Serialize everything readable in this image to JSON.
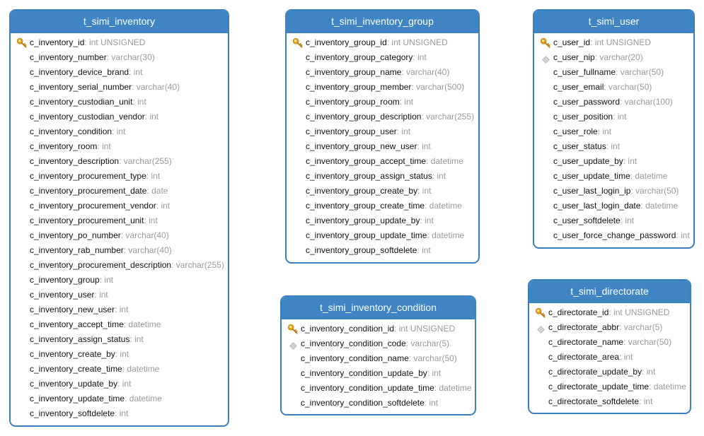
{
  "tables": [
    {
      "id": "tbl-inventory",
      "title": "t_simi_inventory",
      "columns": [
        {
          "name": "c_inventory_id",
          "type": "int UNSIGNED",
          "marker": "key"
        },
        {
          "name": "c_inventory_number",
          "type": "varchar(30)",
          "marker": ""
        },
        {
          "name": "c_inventory_device_brand",
          "type": "int",
          "marker": ""
        },
        {
          "name": "c_inventory_serial_number",
          "type": "varchar(40)",
          "marker": ""
        },
        {
          "name": "c_inventory_custodian_unit",
          "type": "int",
          "marker": ""
        },
        {
          "name": "c_inventory_custodian_vendor",
          "type": "int",
          "marker": ""
        },
        {
          "name": "c_inventory_condition",
          "type": "int",
          "marker": ""
        },
        {
          "name": "c_inventory_room",
          "type": "int",
          "marker": ""
        },
        {
          "name": "c_inventory_description",
          "type": "varchar(255)",
          "marker": ""
        },
        {
          "name": "c_inventory_procurement_type",
          "type": "int",
          "marker": ""
        },
        {
          "name": "c_inventory_procurement_date",
          "type": "date",
          "marker": ""
        },
        {
          "name": "c_inventory_procurement_vendor",
          "type": "int",
          "marker": ""
        },
        {
          "name": "c_inventory_procurement_unit",
          "type": "int",
          "marker": ""
        },
        {
          "name": "c_inventory_po_number",
          "type": "varchar(40)",
          "marker": ""
        },
        {
          "name": "c_inventory_rab_number",
          "type": "varchar(40)",
          "marker": ""
        },
        {
          "name": "c_inventory_procurement_description",
          "type": "varchar(255)",
          "marker": ""
        },
        {
          "name": "c_inventory_group",
          "type": "int",
          "marker": ""
        },
        {
          "name": "c_inventory_user",
          "type": "int",
          "marker": ""
        },
        {
          "name": "c_inventory_new_user",
          "type": "int",
          "marker": ""
        },
        {
          "name": "c_inventory_accept_time",
          "type": "datetime",
          "marker": ""
        },
        {
          "name": "c_inventory_assign_status",
          "type": "int",
          "marker": ""
        },
        {
          "name": "c_inventory_create_by",
          "type": "int",
          "marker": ""
        },
        {
          "name": "c_inventory_create_time",
          "type": "datetime",
          "marker": ""
        },
        {
          "name": "c_inventory_update_by",
          "type": "int",
          "marker": ""
        },
        {
          "name": "c_inventory_update_time",
          "type": "datetime",
          "marker": ""
        },
        {
          "name": "c_inventory_softdelete",
          "type": "int",
          "marker": ""
        }
      ]
    },
    {
      "id": "tbl-inventory-group",
      "title": "t_simi_inventory_group",
      "columns": [
        {
          "name": "c_inventory_group_id",
          "type": "int UNSIGNED",
          "marker": "key"
        },
        {
          "name": "c_inventory_group_category",
          "type": "int",
          "marker": ""
        },
        {
          "name": "c_inventory_group_name",
          "type": "varchar(40)",
          "marker": ""
        },
        {
          "name": "c_inventory_group_member",
          "type": "varchar(500)",
          "marker": ""
        },
        {
          "name": "c_inventory_group_room",
          "type": "int",
          "marker": ""
        },
        {
          "name": "c_inventory_group_description",
          "type": "varchar(255)",
          "marker": ""
        },
        {
          "name": "c_inventory_group_user",
          "type": "int",
          "marker": ""
        },
        {
          "name": "c_inventory_group_new_user",
          "type": "int",
          "marker": ""
        },
        {
          "name": "c_inventory_group_accept_time",
          "type": "datetime",
          "marker": ""
        },
        {
          "name": "c_inventory_group_assign_status",
          "type": "int",
          "marker": ""
        },
        {
          "name": "c_inventory_group_create_by",
          "type": "int",
          "marker": ""
        },
        {
          "name": "c_inventory_group_create_time",
          "type": "datetime",
          "marker": ""
        },
        {
          "name": "c_inventory_group_update_by",
          "type": "int",
          "marker": ""
        },
        {
          "name": "c_inventory_group_update_time",
          "type": "datetime",
          "marker": ""
        },
        {
          "name": "c_inventory_group_softdelete",
          "type": "int",
          "marker": ""
        }
      ]
    },
    {
      "id": "tbl-user",
      "title": "t_simi_user",
      "columns": [
        {
          "name": "c_user_id",
          "type": "int UNSIGNED",
          "marker": "key"
        },
        {
          "name": "c_user_nip",
          "type": "varchar(20)",
          "marker": "unique"
        },
        {
          "name": "c_user_fullname",
          "type": "varchar(50)",
          "marker": ""
        },
        {
          "name": "c_user_email",
          "type": "varchar(50)",
          "marker": ""
        },
        {
          "name": "c_user_password",
          "type": "varchar(100)",
          "marker": ""
        },
        {
          "name": "c_user_position",
          "type": "int",
          "marker": ""
        },
        {
          "name": "c_user_role",
          "type": "int",
          "marker": ""
        },
        {
          "name": "c_user_status",
          "type": "int",
          "marker": ""
        },
        {
          "name": "c_user_update_by",
          "type": "int",
          "marker": ""
        },
        {
          "name": "c_user_update_time",
          "type": "datetime",
          "marker": ""
        },
        {
          "name": "c_user_last_login_ip",
          "type": "varchar(50)",
          "marker": ""
        },
        {
          "name": "c_user_last_login_date",
          "type": "datetime",
          "marker": ""
        },
        {
          "name": "c_user_softdelete",
          "type": "int",
          "marker": ""
        },
        {
          "name": "c_user_force_change_password",
          "type": "int",
          "marker": ""
        }
      ]
    },
    {
      "id": "tbl-inventory-condition",
      "title": "t_simi_inventory_condition",
      "columns": [
        {
          "name": "c_inventory_condition_id",
          "type": "int UNSIGNED",
          "marker": "key"
        },
        {
          "name": "c_inventory_condition_code",
          "type": "varchar(5)",
          "marker": "unique"
        },
        {
          "name": "c_inventory_condition_name",
          "type": "varchar(50)",
          "marker": ""
        },
        {
          "name": "c_inventory_condition_update_by",
          "type": "int",
          "marker": ""
        },
        {
          "name": "c_inventory_condition_update_time",
          "type": "datetime",
          "marker": ""
        },
        {
          "name": "c_inventory_condition_softdelete",
          "type": "int",
          "marker": ""
        }
      ]
    },
    {
      "id": "tbl-directorate",
      "title": "t_simi_directorate",
      "columns": [
        {
          "name": "c_directorate_id",
          "type": "int UNSIGNED",
          "marker": "key"
        },
        {
          "name": "c_directorate_abbr",
          "type": "varchar(5)",
          "marker": "unique"
        },
        {
          "name": "c_directorate_name",
          "type": "varchar(50)",
          "marker": ""
        },
        {
          "name": "c_directorate_area",
          "type": "int",
          "marker": ""
        },
        {
          "name": "c_directorate_update_by",
          "type": "int",
          "marker": ""
        },
        {
          "name": "c_directorate_update_time",
          "type": "datetime",
          "marker": ""
        },
        {
          "name": "c_directorate_softdelete",
          "type": "int",
          "marker": ""
        }
      ]
    }
  ],
  "colors": {
    "header_bg": "#3f85c4",
    "border": "#3a7fbf",
    "key": "#e8a317",
    "unique": "#c8c8c8",
    "type_text": "#999999"
  }
}
